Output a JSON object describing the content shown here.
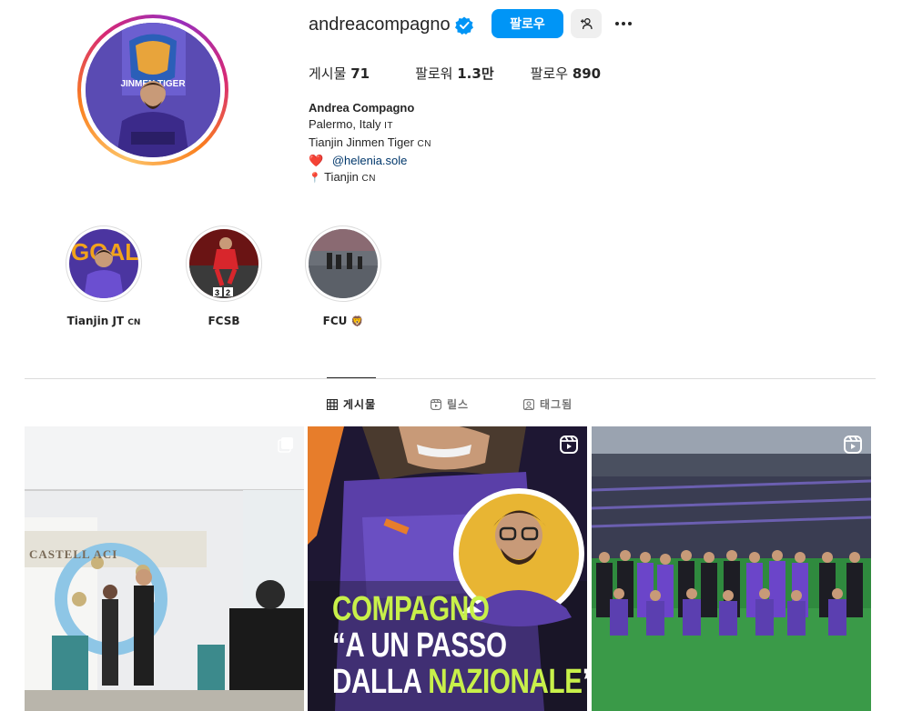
{
  "profile": {
    "username": "andreacompagno",
    "verified": true,
    "follow_label": "팔로우",
    "suggest_icon": "add-person-icon",
    "more_icon": "more-options-icon",
    "stats": {
      "posts_label": "게시물",
      "posts_value": "71",
      "followers_label": "팔로워",
      "followers_value": "1.3만",
      "following_label": "팔로우",
      "following_value": "890"
    },
    "bio": {
      "full_name": "Andrea Compagno",
      "line1": "Palermo, Italy",
      "line1_flag": "IT",
      "line2": "Tianjin Jinmen Tiger",
      "line2_flag": "CN",
      "line3_emoji": "❤️",
      "line3_mention": "@helenia.sole",
      "line4_emoji": "📍",
      "line4": "Tianjin",
      "line4_flag": "CN"
    }
  },
  "highlights": [
    {
      "label": "Tianjin JT",
      "flag": "CN"
    },
    {
      "label": "FCSB",
      "flag": ""
    },
    {
      "label": "FCU",
      "emoji": "🦁"
    }
  ],
  "tabs": [
    {
      "label": "게시물",
      "icon": "grid-icon",
      "active": true
    },
    {
      "label": "릴스",
      "icon": "reels-icon",
      "active": false
    },
    {
      "label": "태그됨",
      "icon": "tagged-icon",
      "active": false
    }
  ],
  "posts": [
    {
      "type": "carousel",
      "icon": "carousel-icon",
      "sign_text": "CASTELL ACI"
    },
    {
      "type": "reel",
      "icon": "reels-icon",
      "headline_1": "COMPAGNO",
      "headline_2": "“A UN PASSO",
      "headline_3a": "DALLA ",
      "headline_3b": "NAZIONALE",
      "headline_3c": "”"
    },
    {
      "type": "reel",
      "icon": "reels-icon"
    }
  ],
  "colors": {
    "accent": "#0095f6",
    "verified": "#0095f6",
    "text": "#262626",
    "muted": "#737373",
    "mention": "#00376b",
    "headline_green": "#c8f04a"
  }
}
